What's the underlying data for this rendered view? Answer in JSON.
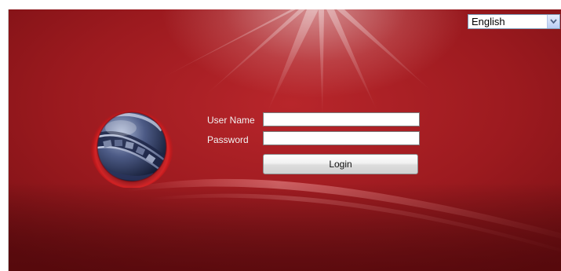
{
  "language_select": {
    "value": "English",
    "icon": "chevron-down-icon"
  },
  "login_form": {
    "username_label": "User Name",
    "password_label": "Password",
    "username_value": "",
    "password_value": "",
    "login_label": "Login"
  },
  "colors": {
    "background_red": "#9c1a1f",
    "dark_red": "#6e0d11",
    "label_text": "#f2f2f2"
  },
  "logo": {
    "icon": "globe-logo-icon"
  }
}
